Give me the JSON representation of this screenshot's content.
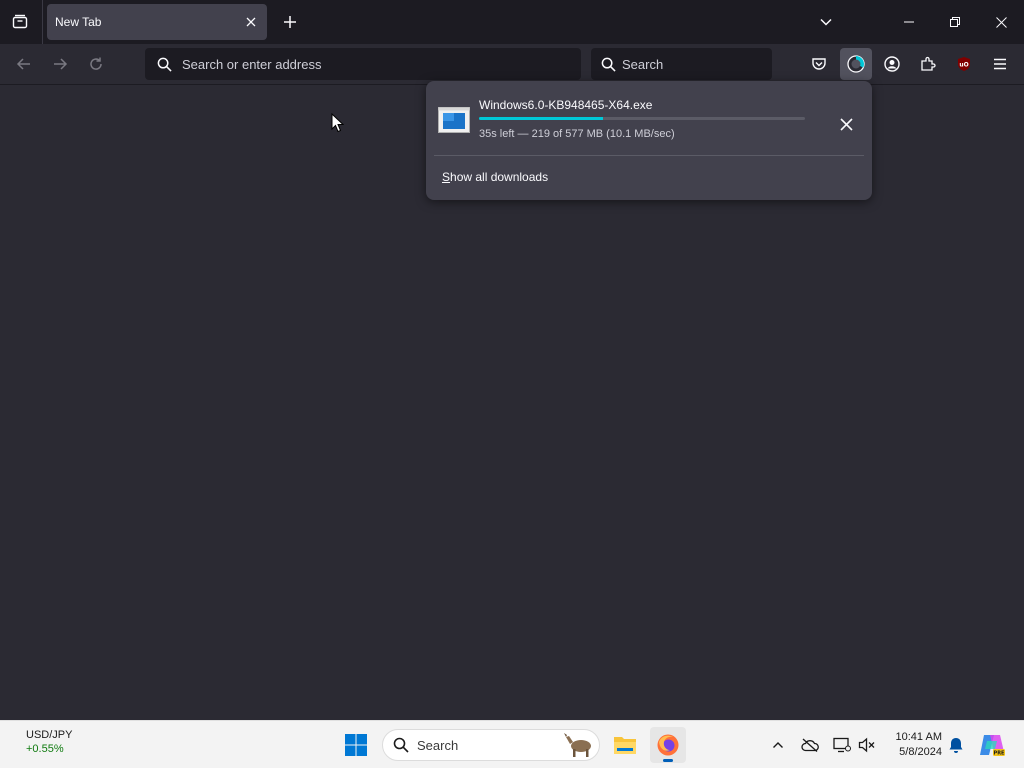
{
  "browser": {
    "tab": {
      "title": "New Tab"
    },
    "urlbar": {
      "placeholder": "Search or enter address"
    },
    "searchbar": {
      "placeholder": "Search"
    }
  },
  "downloads": {
    "item": {
      "filename": "Windows6.0-KB948465-X64.exe",
      "status": "35s left — 219 of 577 MB (10.1 MB/sec)",
      "progress": 0.38
    },
    "show_all": "Show all downloads",
    "show_all_accesskey": "S",
    "show_all_rest": "how all downloads"
  },
  "taskbar": {
    "ticker": {
      "symbol": "USD/JPY",
      "change": "+0.55%"
    },
    "search_label": "Search",
    "clock": {
      "time": "10:41 AM",
      "date": "5/8/2024"
    }
  },
  "colors": {
    "accent": "#00c8d7",
    "chrome_bg": "#1c1b22",
    "content_bg": "#2b2a33",
    "panel_bg": "#42414d",
    "ticker_up": "#0f7b0f"
  },
  "icons": {
    "tab_list": "tab-list-icon",
    "close": "close-icon",
    "plus": "plus-icon",
    "back": "back-arrow-icon",
    "forward": "forward-arrow-icon",
    "reload": "reload-icon",
    "search": "search-icon",
    "pocket": "pocket-icon",
    "downloads": "downloads-progress-icon",
    "account": "account-icon",
    "extensions": "extensions-icon",
    "ublock": "ublock-icon",
    "menu": "hamburger-menu-icon",
    "windows_start": "windows-start-icon",
    "file_explorer": "file-explorer-icon",
    "firefox": "firefox-icon",
    "copilot": "copilot-icon"
  }
}
